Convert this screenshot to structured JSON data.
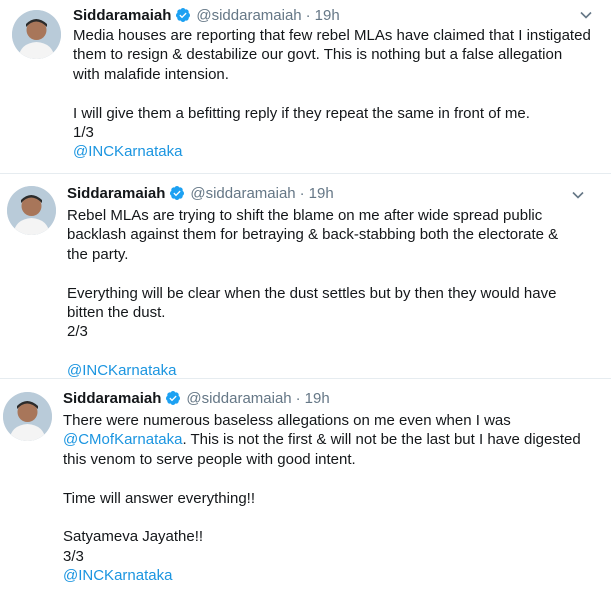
{
  "accent_color": "#1b95e0",
  "tweets": [
    {
      "name": "Siddaramaiah",
      "handle": "@siddaramaiah",
      "dot": "·",
      "time": "19h",
      "lines": [
        "Media houses are reporting that few rebel MLAs have claimed that I instigated",
        "them to resign & destabilize our govt. This is nothing but a false allegation",
        "with malafide intension.",
        "",
        "I will give them a befitting reply if they repeat the same in front of me.",
        "1/3"
      ],
      "mention": "@INCKarnataka"
    },
    {
      "name": "Siddaramaiah",
      "handle": "@siddaramaiah",
      "dot": "·",
      "time": "19h",
      "lines": [
        "Rebel MLAs are trying to shift the blame on me after wide spread public",
        "backlash against them for betraying & back-stabbing both the electorate &",
        "the party.",
        "",
        "Everything will be clear when the dust settles but by then they would have",
        "bitten the dust.",
        "2/3",
        ""
      ],
      "mention": "@INCKarnataka"
    },
    {
      "name": "Siddaramaiah",
      "handle": "@siddaramaiah",
      "dot": "·",
      "time": "19h",
      "line1": "There were numerous baseless allegations on me even when I was",
      "inline_mention": "@CMofKarnataka",
      "line2_rest": ". This is not the first & will not be the last but I have digested",
      "lines_after": [
        "this venom to serve people with good intent.",
        "",
        "Time will answer everything!!",
        "",
        "Satyameva Jayathe!!",
        "3/3"
      ],
      "mention": "@INCKarnataka"
    }
  ]
}
